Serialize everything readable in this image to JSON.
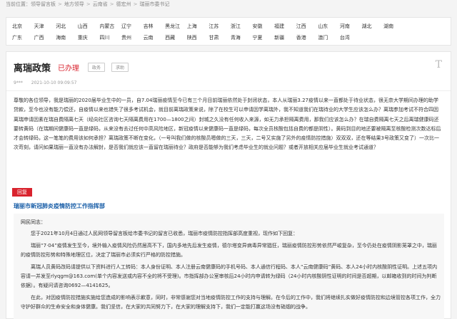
{
  "breadcrumb": {
    "prefix": "当前位置：",
    "items": [
      "领导留言板",
      "地方领导",
      "云南省",
      "德宏州",
      "瑞丽市委书记"
    ],
    "separator": ">"
  },
  "regions": {
    "row1": [
      "北京",
      "天津",
      "河北",
      "山西",
      "内蒙古",
      "辽宁",
      "吉林",
      "黑龙江",
      "上海",
      "江苏",
      "浙江",
      "安徽",
      "福建",
      "江西",
      "山东",
      "河南",
      "湖北",
      "湖南"
    ],
    "row2": [
      "广东",
      "广西",
      "海南",
      "重庆",
      "四川",
      "贵州",
      "云南",
      "西藏",
      "陕西",
      "甘肃",
      "青海",
      "宁夏",
      "新疆",
      "香港",
      "澳门",
      "台湾"
    ]
  },
  "message": {
    "title": "离瑞政策",
    "status": "已办理",
    "tag1": "政务",
    "tag2": "求助",
    "font_toggle": "T",
    "author": "9***",
    "date": "2021-10-10 09:09:57",
    "body": "尊敬的各位领导，我是瑞丽的2020届毕业生中的一员，自7.04瑞丽疫情至今已有三个月目前瑞丽依然处于封闭状态，本人从瑞丽3.27疫情以来一直都处于待业状态，很无奈大学期间办理的助学贷款，至今也没有能力偿还，自疫情以来也错失了很多考试机会，就目前离瑞政策来说，除了在校生可以申请因学离瑞外，我不知道我们在瑞待业的大学生应该怎么办？离瑞参加考试不符合四因离瑞申请因素在瑞自费隔离七天（经向社区咨询七天隔离费用在1700—1800之间）封城之久没有任何收入来源，如无力承担隔离费用，那我们应该怎么办？在瑞自费隔离七天之后离瑞健康码还要转黄码（在瑞期间健康码一直是绿码，从来没有去过任何中高风险地区，新冠疫情以来健康码一直是绿码，每次全员核酸包括自费的都是阴性）。黄码到目的地还要被隔离至核酸检测次数达标后才会转绿码，这一笔笔的费用该如何承担？离瑞政策不断在变化，（一号叫我们做的核酸员嗯做的三天，三天，二号又实施了另外的疫情防控措施）双双双，还在等结果3号政策又变了）一次比一次苛刻，请问如果瑞丽一直没有办法解封，是否我们就应该一直留在瑞丽待业？政府是否能够为我们考虑毕业生的就业问题？或者开放相关应届毕业生就业考试通道？"
  },
  "reply": {
    "label": "回复",
    "org": "瑞丽市新冠肺炎疫情防控工作指挥部",
    "salutation": "网民同志：",
    "p1": "您于2021年10月4日通过人民网领导留言板给市委书记的留言已收悉，瑞丽市疫情防控指挥部高度重视，现作如下回复：",
    "p2": "瑞丽“7·04”疫情发生至今，境外输入疫情风险仍然居高不下，国内多地先后发生疫情，德尔塔变异病毒异常猖狂，瑞丽疫情防控形势依然严峻复杂，至今仍处在疫情阴影笼罩之中，瑞丽的疫情防控形势和特殊地理区位，决定了瑞丽市必须实行严格的防控措施。",
    "p3": "离瑞人员黄码改码请提供以下资料进行人工转码：本人身份证明、本人注册云南健康码的手机号码、本人通信行程码、本人“云南健康码”黄码、本人24小时内核酸阴性证明。上述五项内容请一并发至rlyqgm@163.com(单个内容发送或内容不全的将不受理)。市指挥部办公室审核后24小时内申请转为绿码（24小时内核酸阴性证明的时间是否超期，以邮箱收到的时间为判断依据）。有疑问请咨询0692—4141625。",
    "p4": "在此，对因疫情防控措施实施给您造成的影响表示歉意，同时，非常感谢您对当地疫情防控工作的支持与理解。在今后的工作中，我们将继续扎实做好疫情防控和边境管控各项工作，全力守护好群众的生命安全和身体健康。我们坚信，在大家的共同努力下，在大家的理解支持下，我们一定能打赢这场没有硝烟的战争。"
  }
}
